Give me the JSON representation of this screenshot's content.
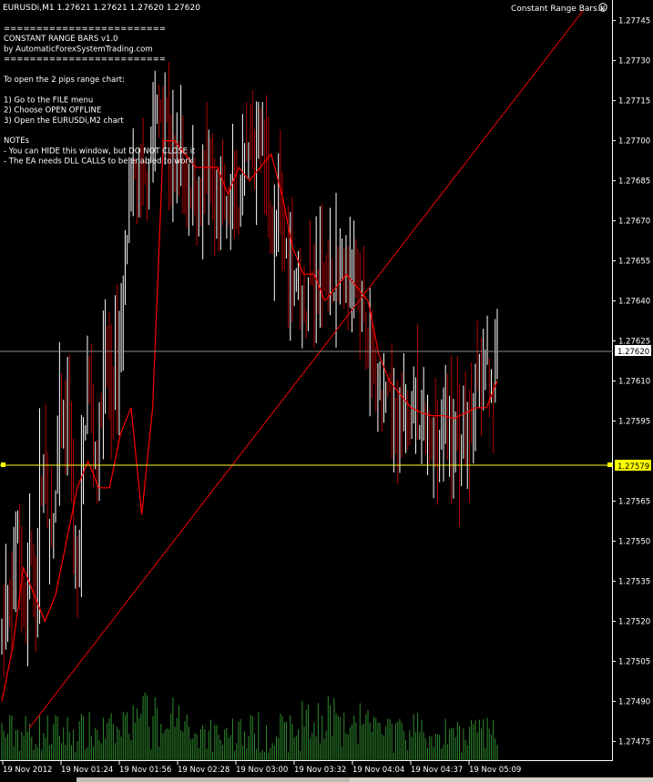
{
  "window": {
    "symbol_line": "EURUSDi,M1  1.27621 1.27621 1.27620 1.27620",
    "indicator_label": "Constant Range Bars.x"
  },
  "panel": {
    "lines": [
      "=========================",
      "    CONSTANT RANGE BARS v1.0",
      "  by AutomaticForexSystemTrading.com",
      "=========================",
      "",
      "To open the 2 pips range chart:",
      "",
      " 1) Go to the FILE menu",
      " 2) Choose OPEN OFFLINE",
      " 3) Open the EURUSDi,M2 chart",
      "",
      "NOTEs",
      " - You can HIDE this window, but DO NOT CLOSE it",
      " - The EA needs DLL CALLS to be enabled to work"
    ]
  },
  "colors": {
    "background": "#000000",
    "bull_bar": "#ffffff",
    "bear_bar": "#b00000",
    "moving_average": "#ff0000",
    "trendline": "#cc0000",
    "volume": "#2e8b2e",
    "horizontal_line": "#ffff00",
    "bid_line": "#8a8a8a",
    "axis_text": "#ffffff"
  },
  "chart_data": {
    "type": "candlestick",
    "symbol": "EURUSDi",
    "timeframe": "M1",
    "ylim": [
      1.27468,
      1.27752
    ],
    "y_ticks": [
      "1.27745",
      "1.27730",
      "1.27715",
      "1.27700",
      "1.27685",
      "1.27670",
      "1.27655",
      "1.27640",
      "1.27625",
      "1.27610",
      "1.27595",
      "1.27565",
      "1.27550",
      "1.27535",
      "1.27520",
      "1.27505",
      "1.27490",
      "1.27475"
    ],
    "x_ticks": [
      "19 Nov 2012",
      "19 Nov 01:24",
      "19 Nov 01:56",
      "19 Nov 02:28",
      "19 Nov 03:00",
      "19 Nov 03:32",
      "19 Nov 04:04",
      "19 Nov 04:37",
      "19 Nov 05:09"
    ],
    "current_price": "1.27620",
    "horizontal_line_price": "1.27579",
    "price_path": [
      1.2751,
      1.2753,
      1.27525,
      1.2756,
      1.2754,
      1.27515,
      1.2755,
      1.2753,
      1.2757,
      1.2758,
      1.2755,
      1.2756,
      1.2759,
      1.27585,
      1.27595,
      1.27555,
      1.2753,
      1.2758,
      1.27615,
      1.2759,
      1.2758,
      1.27605,
      1.2762,
      1.2761,
      1.27615,
      1.2763,
      1.2766,
      1.2768,
      1.27685,
      1.2769,
      1.2768,
      1.277,
      1.27705,
      1.2771,
      1.27715,
      1.277,
      1.2769,
      1.27695,
      1.2769,
      1.2768,
      1.27685,
      1.27675,
      1.2768,
      1.27685,
      1.27678,
      1.27672,
      1.2768,
      1.2767,
      1.27675,
      1.2768,
      1.2767,
      1.27685,
      1.27695,
      1.2769,
      1.2771,
      1.27695,
      1.2768,
      1.2766,
      1.2767,
      1.27665,
      1.2766,
      1.2765,
      1.27655,
      1.2764,
      1.27635,
      1.2765,
      1.27645,
      1.2765,
      1.27655,
      1.2765,
      1.27648,
      1.2765,
      1.27645,
      1.27655,
      1.27645,
      1.2764,
      1.2763,
      1.2762,
      1.2761,
      1.27605,
      1.276,
      1.276,
      1.27595,
      1.276,
      1.2759,
      1.276,
      1.27595,
      1.276,
      1.2759,
      1.27595,
      1.2758,
      1.27595,
      1.2759,
      1.276,
      1.27592,
      1.2759,
      1.27585,
      1.27595,
      1.2759,
      1.276,
      1.2761,
      1.27605,
      1.27615,
      1.2761,
      1.2762
    ],
    "ma_path": [
      1.2749,
      1.2751,
      1.2754,
      1.2753,
      1.2752,
      1.2753,
      1.2755,
      1.2757,
      1.2758,
      1.2757,
      1.2757,
      1.2759,
      1.276,
      1.2756,
      1.276,
      1.277,
      1.277,
      1.27695,
      1.2769,
      1.2769,
      1.2769,
      1.2768,
      1.2769,
      1.27685,
      1.2769,
      1.27695,
      1.2768,
      1.2766,
      1.2765,
      1.2765,
      1.2764,
      1.27645,
      1.2765,
      1.27645,
      1.2764,
      1.2762,
      1.2761,
      1.27605,
      1.276,
      1.27598,
      1.27597,
      1.27597,
      1.27596,
      1.27598,
      1.276,
      1.276,
      1.2761
    ],
    "trendline": [
      [
        0,
        1.27475
      ],
      [
        1,
        1.27755
      ]
    ]
  }
}
